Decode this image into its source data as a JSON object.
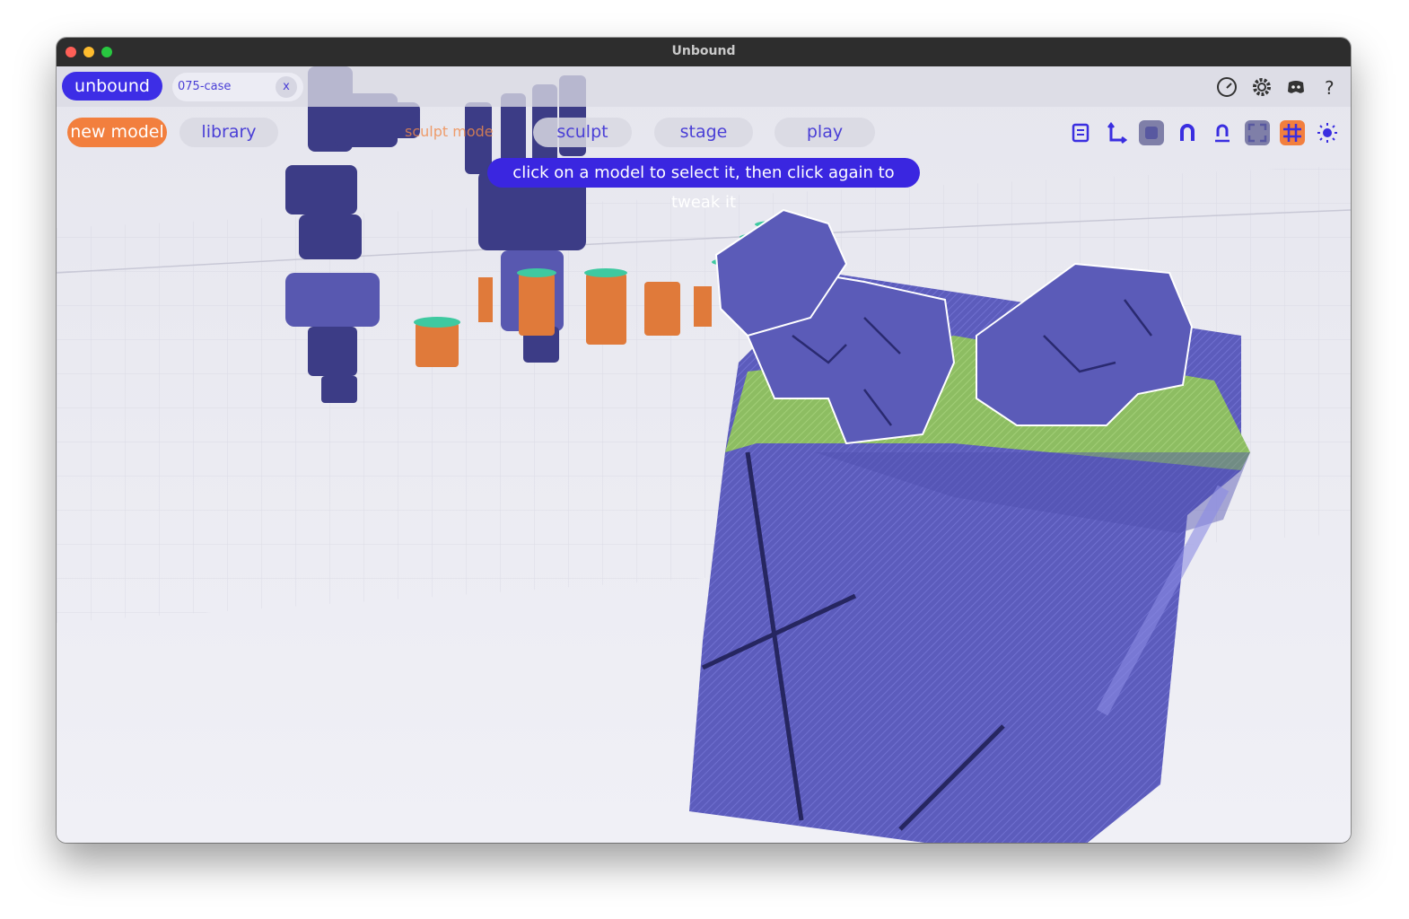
{
  "window": {
    "title": "Unbound"
  },
  "header": {
    "brand": "unbound",
    "file_name": "075-case",
    "close_label": "x"
  },
  "nav": {
    "new_model": "new model",
    "library": "library",
    "mode_label": "sculpt mode",
    "sculpt": "sculpt",
    "stage": "stage",
    "play": "play"
  },
  "hint": "click on a model to select it, then click again to tweak it",
  "top_icons": [
    "gauge-icon",
    "gear-icon",
    "discord-icon",
    "help-icon"
  ],
  "toolbar_icons": [
    "list-icon",
    "axes-icon",
    "cube-icon",
    "magnet-icon",
    "person-magnet-icon",
    "frame-icon",
    "grid-icon",
    "sun-icon"
  ],
  "colors": {
    "accent": "#3d2ee6",
    "orange": "#f27f3e",
    "model_blue": "#5f5fb8",
    "grass": "#8fbf5a"
  }
}
